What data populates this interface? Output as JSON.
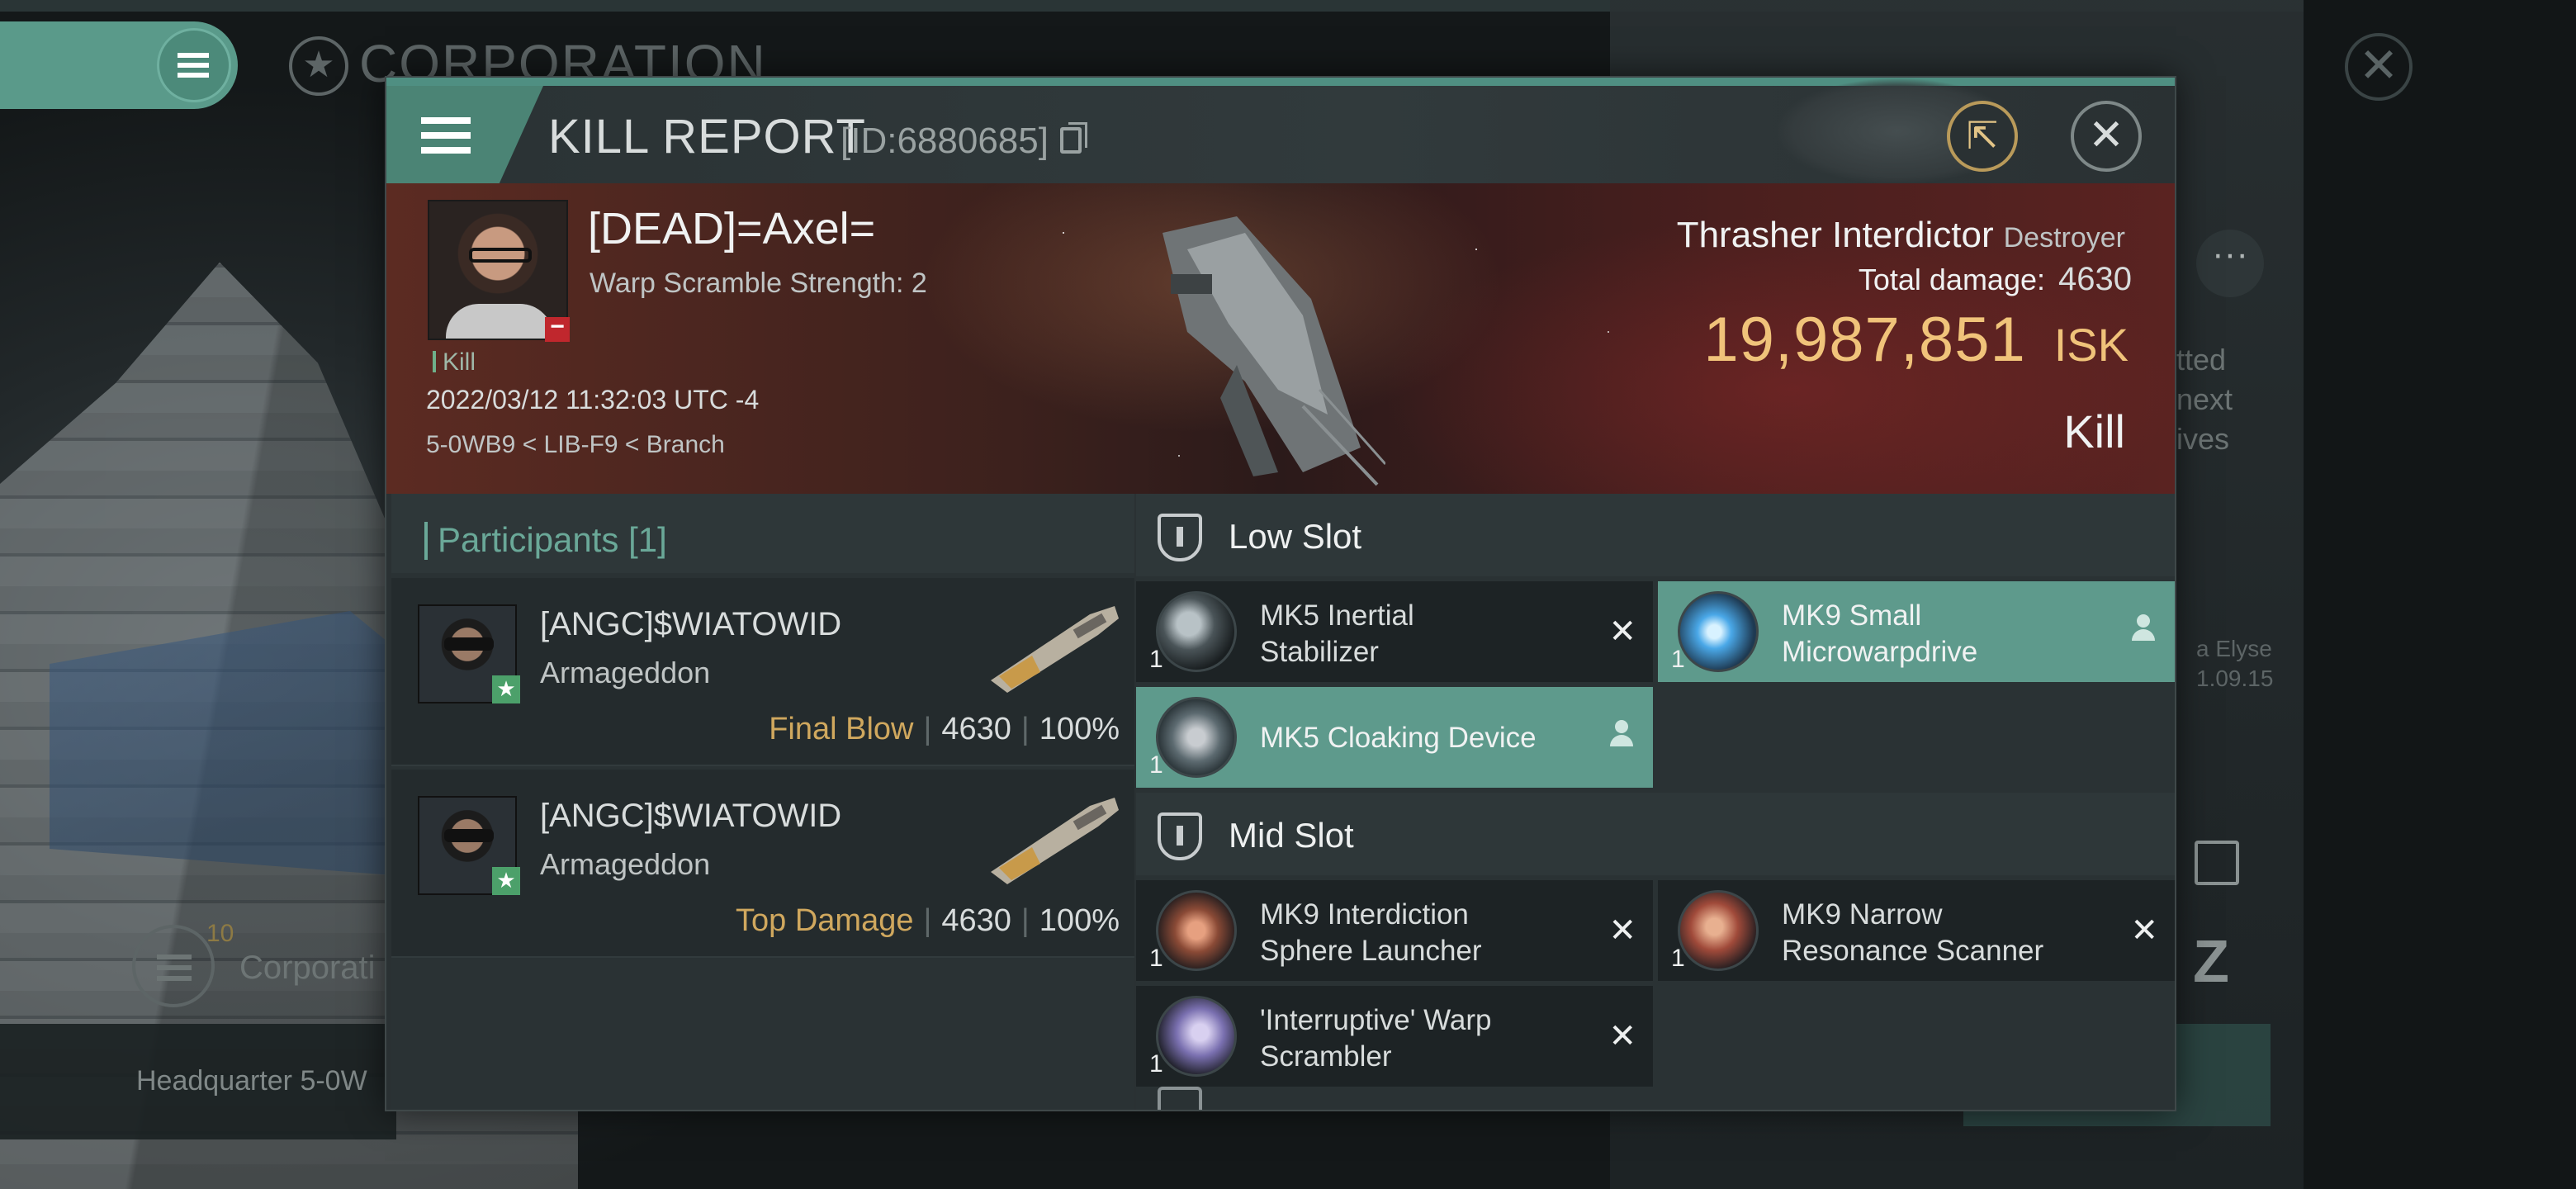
{
  "background": {
    "corp_title": "CORPORATION",
    "side_text_lines": [
      "tted",
      "next",
      "ives"
    ],
    "side_small_lines": [
      "a Elyse",
      "1.09.15"
    ],
    "corp_count": "10",
    "corp_label": "Corporati",
    "hq_label": "Headquarter 5-0W"
  },
  "modal": {
    "title": "KILL REPORT",
    "id_text": "[ID:6880685]",
    "victim": {
      "name": "[DEAD]=Axel=",
      "subtitle": "Warp Scramble Strength: 2",
      "tag": "Kill",
      "datetime": "2022/03/12 11:32:03 UTC -4",
      "location": "5-0WB9 < LIB-F9 < Branch"
    },
    "ship": {
      "name": "Thrasher Interdictor",
      "class": "Destroyer",
      "damage_label": "Total damage:",
      "damage_value": "4630",
      "isk_value": "19,987,851",
      "isk_unit": "ISK",
      "result": "Kill"
    },
    "participants": {
      "header": "Participants [1]",
      "rows": [
        {
          "name": "[ANGC]$WIATOWID",
          "ship": "Armageddon",
          "role": "Final Blow",
          "damage": "4630",
          "percent": "100%"
        },
        {
          "name": "[ANGC]$WIATOWID",
          "ship": "Armageddon",
          "role": "Top Damage",
          "damage": "4630",
          "percent": "100%"
        }
      ]
    },
    "slots": {
      "low": {
        "title": "Low Slot",
        "modules": [
          {
            "qty": "1",
            "line1": "MK5 Inertial",
            "line2": "Stabilizer",
            "state": "destroyed"
          },
          {
            "qty": "1",
            "line1": "MK9 Small",
            "line2": "Microwarpdrive",
            "state": "dropped"
          },
          {
            "qty": "1",
            "line1": "MK5 Cloaking Device",
            "line2": "",
            "state": "dropped"
          }
        ]
      },
      "mid": {
        "title": "Mid Slot",
        "modules": [
          {
            "qty": "1",
            "line1": "MK9 Interdiction",
            "line2": "Sphere Launcher",
            "state": "destroyed"
          },
          {
            "qty": "1",
            "line1": "MK9 Narrow",
            "line2": "Resonance Scanner",
            "state": "destroyed"
          },
          {
            "qty": "1",
            "line1": "'Interruptive' Warp",
            "line2": "Scrambler",
            "state": "destroyed"
          }
        ]
      }
    }
  },
  "icons": {
    "destroyed": "close-x-icon",
    "dropped": "person-icon",
    "share": "share-icon",
    "close": "close-icon"
  },
  "colors": {
    "accent_teal": "#5e9a8c",
    "isk_gold": "#f0c37a",
    "final_blow": "#d0a85e"
  }
}
